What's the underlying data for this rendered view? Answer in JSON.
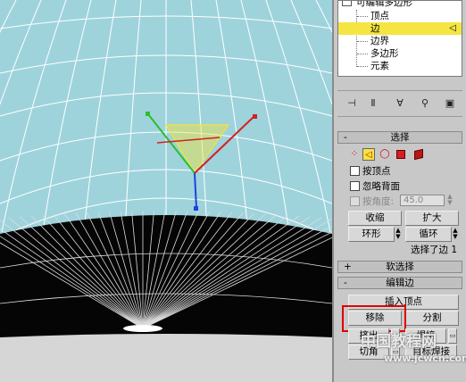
{
  "modifier_stack": {
    "top_item": "可编辑多边形",
    "sub_items": [
      "顶点",
      "边",
      "边界",
      "多边形",
      "元素"
    ],
    "selected_index": 1
  },
  "toolbar_icons": [
    "pin-stack-icon",
    "show-end-result-icon",
    "make-unique-icon",
    "remove-modifier-icon",
    "configure-modifier-sets-icon"
  ],
  "selection_rollout": {
    "sign": "-",
    "title": "选择",
    "by_vertex": "按顶点",
    "ignore_backfacing": "忽略背面",
    "by_angle": "按角度:",
    "angle_value": "45.0",
    "shrink": "收缩",
    "grow": "扩大",
    "ring": "环形",
    "loop": "循环",
    "status": "选择了边 1"
  },
  "soft_selection_rollout": {
    "sign": "+",
    "title": "软选择"
  },
  "edit_edges_rollout": {
    "sign": "-",
    "title": "编辑边",
    "insert_vertex": "插入顶点",
    "remove": "移除",
    "split": "分割",
    "extrude": "挤出",
    "weld": "焊接",
    "chamfer": "切角",
    "target_weld": "目标焊接"
  },
  "watermark": {
    "line1": "中国教程网",
    "line2": "www.jcwcn.com"
  },
  "colors": {
    "viewport_bg": "#9ed3dc",
    "mesh_fill_dark": "#050505",
    "gizmo_yellow": "#f2e33a",
    "selected_item": "#f4e542",
    "highlight_red": "#e00000"
  }
}
